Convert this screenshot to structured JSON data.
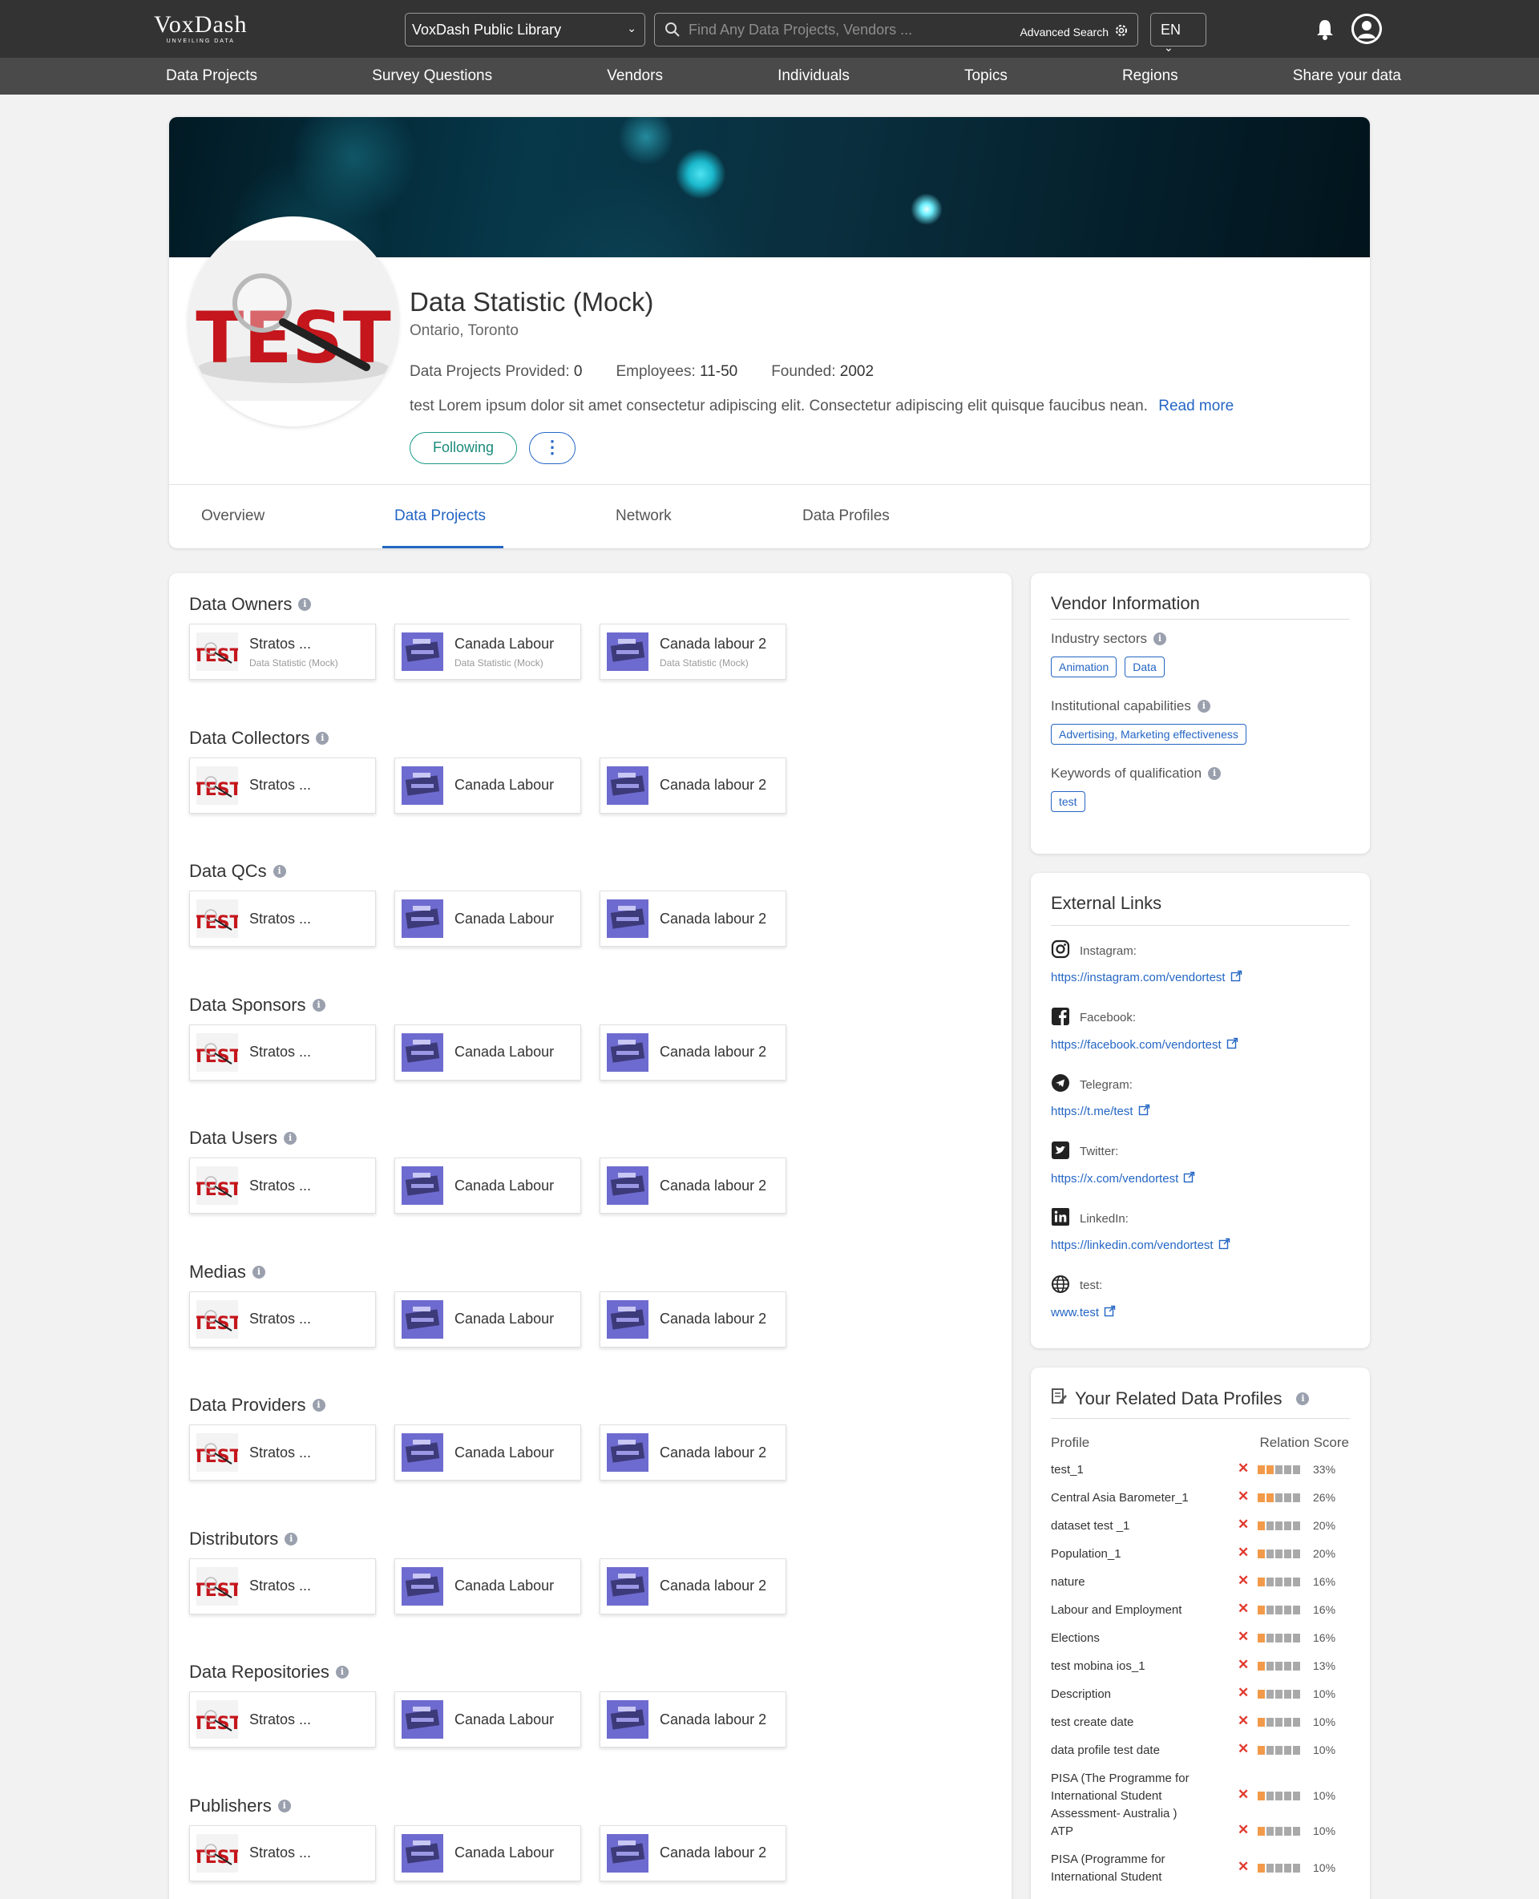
{
  "header": {
    "logo_brand": "VoxDash",
    "logo_tagline": "UNVEILING DATA",
    "library_select": "VoxDash Public Library",
    "search_placeholder": "Find Any Data Projects, Vendors ...",
    "advanced_search": "Advanced Search",
    "language": "EN"
  },
  "nav": [
    "Data Projects",
    "Survey Questions",
    "Vendors",
    "Individuals",
    "Topics",
    "Regions",
    "Share your data"
  ],
  "profile": {
    "name": "Data Statistic (Mock)",
    "location": "Ontario, Toronto",
    "stats": [
      {
        "label": "Data Projects Provided:",
        "value": "0"
      },
      {
        "label": "Employees:",
        "value": "11-50"
      },
      {
        "label": "Founded:",
        "value": "2002"
      }
    ],
    "description": "test Lorem ipsum dolor sit amet consectetur adipiscing elit. Consectetur adipiscing elit quisque faucibus nean.",
    "read_more": "Read more",
    "follow_label": "Following",
    "more_label": "⋮",
    "logo_text": "TEST"
  },
  "tabs": [
    "Overview",
    "Data Projects",
    "Network",
    "Data Profiles"
  ],
  "active_tab": "Data Projects",
  "sections": [
    {
      "title": "Data Owners",
      "tiles": [
        {
          "name": "Stratos ...",
          "sub": "Data Statistic (Mock)",
          "kind": "test"
        },
        {
          "name": "Canada Labour",
          "sub": "Data Statistic (Mock)",
          "kind": "dataset"
        },
        {
          "name": "Canada labour 2",
          "sub": "Data Statistic (Mock)",
          "kind": "dataset"
        }
      ]
    },
    {
      "title": "Data Collectors",
      "tiles": [
        {
          "name": "Stratos ...",
          "sub": "",
          "kind": "test"
        },
        {
          "name": "Canada Labour",
          "sub": "",
          "kind": "dataset"
        },
        {
          "name": "Canada labour 2",
          "sub": "",
          "kind": "dataset"
        }
      ]
    },
    {
      "title": "Data QCs",
      "tiles": [
        {
          "name": "Stratos ...",
          "sub": "",
          "kind": "test"
        },
        {
          "name": "Canada Labour",
          "sub": "",
          "kind": "dataset"
        },
        {
          "name": "Canada labour 2",
          "sub": "",
          "kind": "dataset"
        }
      ]
    },
    {
      "title": "Data Sponsors",
      "tiles": [
        {
          "name": "Stratos ...",
          "sub": "",
          "kind": "test"
        },
        {
          "name": "Canada Labour",
          "sub": "",
          "kind": "dataset"
        },
        {
          "name": "Canada labour 2",
          "sub": "",
          "kind": "dataset"
        }
      ]
    },
    {
      "title": "Data Users",
      "tiles": [
        {
          "name": "Stratos ...",
          "sub": "",
          "kind": "test"
        },
        {
          "name": "Canada Labour",
          "sub": "",
          "kind": "dataset"
        },
        {
          "name": "Canada labour 2",
          "sub": "",
          "kind": "dataset"
        }
      ]
    },
    {
      "title": "Medias",
      "tiles": [
        {
          "name": "Stratos ...",
          "sub": "",
          "kind": "test"
        },
        {
          "name": "Canada Labour",
          "sub": "",
          "kind": "dataset"
        },
        {
          "name": "Canada labour 2",
          "sub": "",
          "kind": "dataset"
        }
      ]
    },
    {
      "title": "Data Providers",
      "tiles": [
        {
          "name": "Stratos ...",
          "sub": "",
          "kind": "test"
        },
        {
          "name": "Canada Labour",
          "sub": "",
          "kind": "dataset"
        },
        {
          "name": "Canada labour 2",
          "sub": "",
          "kind": "dataset"
        }
      ]
    },
    {
      "title": "Distributors",
      "tiles": [
        {
          "name": "Stratos ...",
          "sub": "",
          "kind": "test"
        },
        {
          "name": "Canada Labour",
          "sub": "",
          "kind": "dataset"
        },
        {
          "name": "Canada labour 2",
          "sub": "",
          "kind": "dataset"
        }
      ]
    },
    {
      "title": "Data Repositories",
      "tiles": [
        {
          "name": "Stratos ...",
          "sub": "",
          "kind": "test"
        },
        {
          "name": "Canada Labour",
          "sub": "",
          "kind": "dataset"
        },
        {
          "name": "Canada labour 2",
          "sub": "",
          "kind": "dataset"
        }
      ]
    },
    {
      "title": "Publishers",
      "tiles": [
        {
          "name": "Stratos ...",
          "sub": "",
          "kind": "test"
        },
        {
          "name": "Canada Labour",
          "sub": "",
          "kind": "dataset"
        },
        {
          "name": "Canada labour 2",
          "sub": "",
          "kind": "dataset"
        }
      ]
    }
  ],
  "vendor_info": {
    "title": "Vendor Information",
    "industry_label": "Industry sectors",
    "industry_chips": [
      "Animation",
      "Data"
    ],
    "capabilities_label": "Institutional capabilities",
    "capabilities_chips": [
      "Advertising, Marketing effectiveness"
    ],
    "keywords_label": "Keywords of qualification",
    "keywords_chips": [
      "test"
    ]
  },
  "external_links": {
    "title": "External Links",
    "items": [
      {
        "label": "Instagram:",
        "url": "https://instagram.com/vendortest",
        "icon": "instagram-icon"
      },
      {
        "label": "Facebook:",
        "url": "https://facebook.com/vendortest",
        "icon": "facebook-icon"
      },
      {
        "label": "Telegram:",
        "url": "https://t.me/test",
        "icon": "telegram-icon"
      },
      {
        "label": "Twitter:",
        "url": "https://x.com/vendortest",
        "icon": "twitter-icon"
      },
      {
        "label": "LinkedIn:",
        "url": "https://linkedin.com/vendortest",
        "icon": "linkedin-icon"
      },
      {
        "label": "test:",
        "url": "www.test",
        "icon": "globe-icon"
      }
    ]
  },
  "related_profiles": {
    "title": "Your Related Data Profiles",
    "col_profile": "Profile",
    "col_score": "Relation Score",
    "rows": [
      {
        "name": "test_1",
        "pct": "33%",
        "filled": 2
      },
      {
        "name": "Central Asia Barometer_1",
        "pct": "26%",
        "filled": 2
      },
      {
        "name": "dataset test _1",
        "pct": "20%",
        "filled": 1
      },
      {
        "name": "Population_1",
        "pct": "20%",
        "filled": 1
      },
      {
        "name": "nature",
        "pct": "16%",
        "filled": 1
      },
      {
        "name": "Labour and Employment",
        "pct": "16%",
        "filled": 1
      },
      {
        "name": "Elections",
        "pct": "16%",
        "filled": 1
      },
      {
        "name": "test mobina ios_1",
        "pct": "13%",
        "filled": 1
      },
      {
        "name": "Description",
        "pct": "10%",
        "filled": 1
      },
      {
        "name": "test create date",
        "pct": "10%",
        "filled": 1
      },
      {
        "name": "data profile test date",
        "pct": "10%",
        "filled": 1
      },
      {
        "name": "PISA (The Programme for International Student Assessment- Australia )",
        "pct": "10%",
        "filled": 1
      },
      {
        "name": "ATP",
        "pct": "10%",
        "filled": 1
      },
      {
        "name": "PISA (Programme for International Student",
        "pct": "10%",
        "filled": 1
      }
    ]
  },
  "colors": {
    "accent": "#2466c4",
    "follow": "#1a9a87",
    "header": "#333333",
    "nav": "#4a4a4a",
    "score_on": "#f29a4a",
    "score_off": "#a9a9a9",
    "x_mark": "#e03a2e"
  }
}
